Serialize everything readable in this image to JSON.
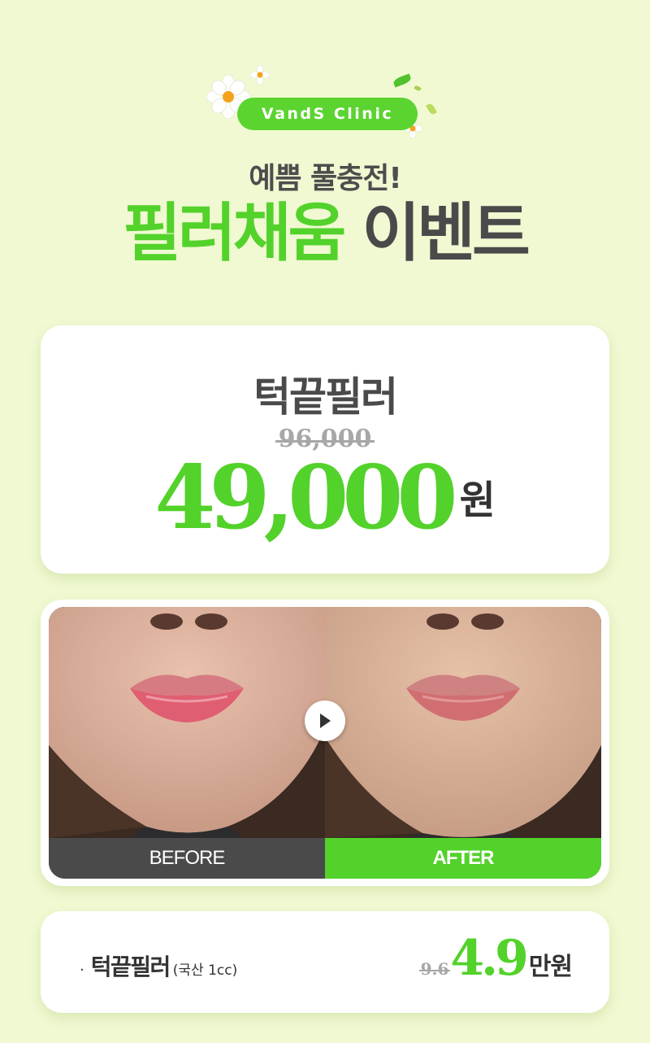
{
  "header": {
    "clinic_name": "VandS Clinic",
    "subtitle": "예쁨 풀충전!",
    "title_green": "필러채움",
    "title_dark": "이벤트"
  },
  "price_card": {
    "product": "턱끝필러",
    "original_price": "96,000",
    "sale_price": "49,000",
    "unit": "원"
  },
  "comparison": {
    "before_label": "BEFORE",
    "after_label": "AFTER"
  },
  "summary": {
    "bullet": "·",
    "product": "턱끝필러",
    "spec": "(국산 1cc)",
    "original_price": "9.6",
    "sale_price": "4.9",
    "unit": "만원"
  },
  "colors": {
    "background": "#f0f9d2",
    "accent_green": "#52d22a",
    "dark_text": "#4a4a4a",
    "strike_gray": "#a7a7a7"
  }
}
